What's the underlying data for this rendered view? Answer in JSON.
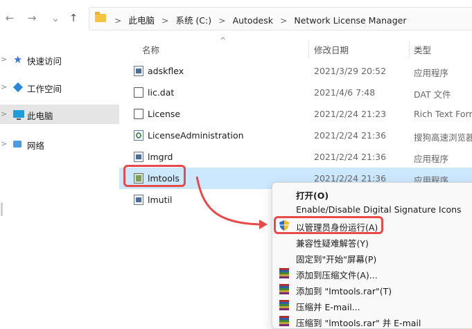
{
  "nav": {
    "back_icon": "arrow-left-icon",
    "forward_icon": "arrow-right-icon",
    "up_icon": "arrow-up-icon",
    "back_glyph": "←",
    "forward_glyph": "→",
    "up_glyph": "↑",
    "breadcrumb": [
      "此电脑",
      "系统 (C:)",
      "Autodesk",
      "Network License Manager"
    ],
    "separator": ">"
  },
  "sidebar": {
    "items": [
      {
        "label": "快速访问",
        "icon": "star-icon"
      },
      {
        "label": "工作空间",
        "icon": "workspace-icon"
      },
      {
        "label": "此电脑",
        "icon": "computer-icon"
      },
      {
        "label": "网络",
        "icon": "network-icon"
      }
    ],
    "chevron": ">"
  },
  "columns": {
    "name": "名称",
    "date": "修改日期",
    "type": "类型",
    "sort_glyph": "^"
  },
  "files": [
    {
      "name": "adskflex",
      "date": "2021/3/29 20:52",
      "type": "应用程序",
      "icon": "exe-icon"
    },
    {
      "name": "lic.dat",
      "date": "2021/4/6 7:48",
      "type": "DAT 文件",
      "icon": "document-icon"
    },
    {
      "name": "License",
      "date": "2021/2/24 21:23",
      "type": "Rich Text Form",
      "icon": "document-icon"
    },
    {
      "name": "LicenseAdministration",
      "date": "2021/2/24 21:36",
      "type": "搜狗高速浏览器",
      "icon": "browser-icon"
    },
    {
      "name": "lmgrd",
      "date": "2021/2/24 21:36",
      "type": "应用程序",
      "icon": "exe-icon"
    },
    {
      "name": "lmtools",
      "date": "2021/2/24 21:36",
      "type": "应用程序",
      "icon": "lmtools-icon"
    },
    {
      "name": "lmutil",
      "date": "",
      "type": "",
      "icon": "exe-icon"
    }
  ],
  "context_menu": {
    "items": [
      {
        "label": "打开(O)",
        "bold": true,
        "icon": ""
      },
      {
        "label": "Enable/Disable Digital Signature Icons",
        "icon": ""
      },
      {
        "label": "以管理员身份运行(A)",
        "icon": "uac-shield-icon"
      },
      {
        "label": "兼容性疑难解答(Y)",
        "icon": ""
      },
      {
        "label": "固定到\"开始\"屏幕(P)",
        "icon": ""
      },
      {
        "label": "添加到压缩文件(A)...",
        "icon": "winrar-icon"
      },
      {
        "label": "添加到 \"lmtools.rar\"(T)",
        "icon": "winrar-icon"
      },
      {
        "label": "压缩并 E-mail...",
        "icon": "winrar-icon"
      },
      {
        "label": "压缩到 \"lmtools.rar\" 并 E-mail",
        "icon": "winrar-icon"
      }
    ]
  },
  "colors": {
    "accent_red": "#e84a4a",
    "selection": "#cce8ff"
  }
}
